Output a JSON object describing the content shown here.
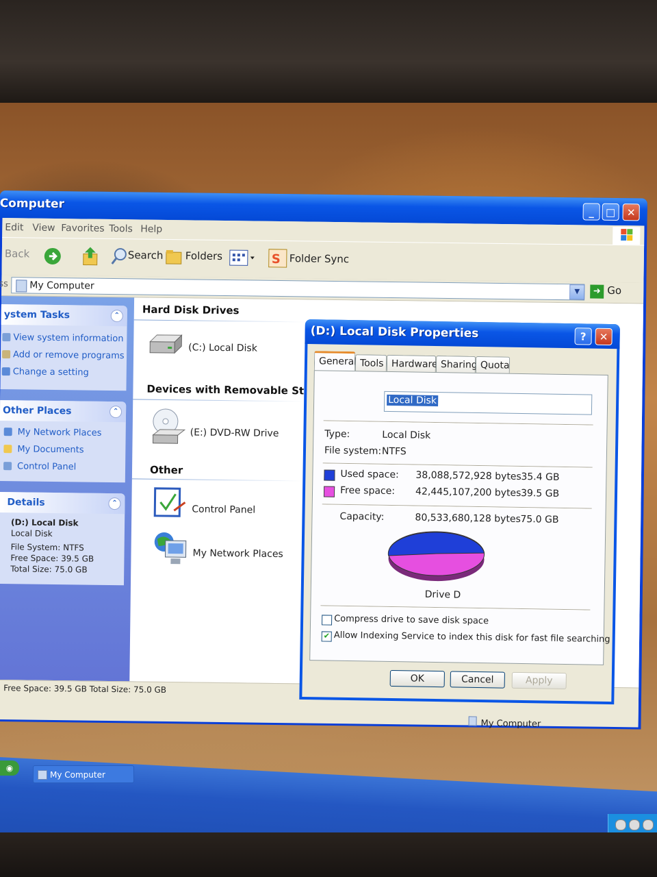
{
  "explorer": {
    "title": "Computer",
    "menu": [
      "Edit",
      "View",
      "Favorites",
      "Tools",
      "Help"
    ],
    "toolbar": {
      "back": "Back",
      "search": "Search",
      "folders": "Folders",
      "folder_sync": "Folder Sync"
    },
    "address": {
      "label": "ss",
      "value": "My Computer",
      "go": "Go"
    },
    "system_tasks": {
      "header": "ystem Tasks",
      "items": [
        "View system information",
        "Add or remove programs",
        "Change a setting"
      ]
    },
    "other_places": {
      "header": "Other Places",
      "items": [
        "My Network Places",
        "My Documents",
        "Control Panel"
      ]
    },
    "details": {
      "header": "Details",
      "name": "(D:) Local Disk",
      "type": "Local Disk",
      "file_system": "File System: NTFS",
      "free_space": "Free Space: 39.5 GB",
      "total_size": "Total Size: 75.0 GB"
    },
    "groups": {
      "hard_disk_drives": "Hard Disk Drives",
      "removable": "Devices with Removable Storage",
      "other": "Other"
    },
    "items": {
      "c_drive": "(C:) Local Disk",
      "e_drive": "(E:) DVD-RW Drive",
      "control_panel": "Control Panel",
      "network_places": "My Network Places"
    },
    "status": {
      "left": "Free Space: 39.5 GB Total Size: 75.0 GB",
      "right": "My Computer"
    }
  },
  "dialog": {
    "title": "(D:) Local Disk Properties",
    "tabs": [
      "General",
      "Tools",
      "Hardware",
      "Sharing",
      "Quota"
    ],
    "name": "Local Disk",
    "type_label": "Type:",
    "type_value": "Local Disk",
    "fs_label": "File system:",
    "fs_value": "NTFS",
    "used_label": "Used space:",
    "used_bytes": "38,088,572,928 bytes",
    "used_gb": "35.4 GB",
    "free_label": "Free space:",
    "free_bytes": "42,445,107,200 bytes",
    "free_gb": "39.5 GB",
    "capacity_label": "Capacity:",
    "capacity_bytes": "80,533,680,128 bytes",
    "capacity_gb": "75.0 GB",
    "drive_label": "Drive D",
    "compress_label": "Compress drive to save disk space",
    "index_label": "Allow Indexing Service to index this disk for fast file searching",
    "ok": "OK",
    "cancel": "Cancel",
    "apply": "Apply",
    "used_color": "#1f3fd8",
    "free_color": "#e64fe0"
  },
  "taskbar": {
    "item": "My Computer"
  }
}
